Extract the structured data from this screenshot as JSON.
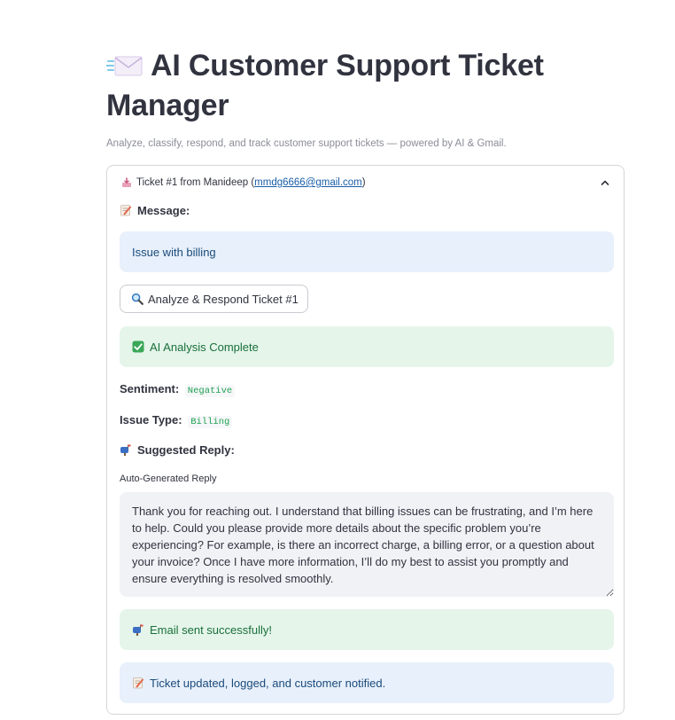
{
  "app": {
    "title": "AI Customer Support Ticket Manager",
    "subtitle": "Analyze, classify, respond, and track customer support tickets — powered by AI & Gmail."
  },
  "ticket": {
    "header_prefix": "Ticket #1 from Manideep (",
    "email": "mmdg6666@gmail.com",
    "header_suffix": ")",
    "message_label": "Message:",
    "message": "Issue with billing",
    "analyze_button": "Analyze & Respond Ticket #1",
    "analysis_status": "AI Analysis Complete",
    "sentiment_label": "Sentiment:",
    "sentiment_value": "Negative",
    "issue_type_label": "Issue Type:",
    "issue_type_value": "Billing",
    "suggested_reply_label": "Suggested Reply:",
    "reply_field_label": "Auto-Generated Reply",
    "reply_text": "Thank you for reaching out. I understand that billing issues can be frustrating, and I’m here to help. Could you please provide more details about the specific problem you’re experiencing? For example, is there an incorrect charge, a billing error, or a question about your invoice? Once I have more information, I’ll do my best to assist you promptly and ensure everything is resolved smoothly.",
    "email_status": "Email sent successfully!",
    "final_status": "Ticket updated, logged, and customer notified."
  },
  "icons": {
    "title": "envelope-icon",
    "ticket": "inbox-tray-icon",
    "message": "memo-icon",
    "analyze": "magnifier-icon",
    "analysis_done": "check-mark-icon",
    "suggested_reply": "mailbox-icon",
    "email_sent": "mailbox-icon",
    "final": "memo-icon",
    "expander": "chevron-up-icon"
  },
  "colors": {
    "info_bg": "#e7f0fb",
    "info_text": "#1b4a7a",
    "success_bg": "#e5f5ea",
    "success_text": "#19703a",
    "code_text": "#21a153",
    "link": "#1a5ea8"
  }
}
